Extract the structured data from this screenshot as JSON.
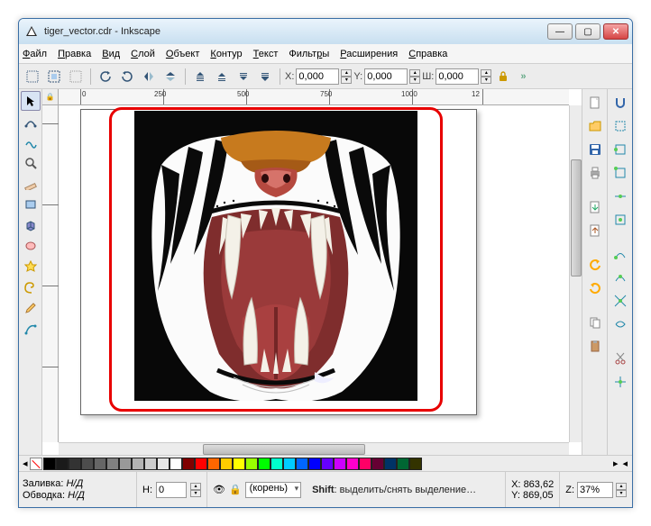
{
  "window": {
    "title": "tiger_vector.cdr - Inkscape"
  },
  "menu": {
    "items": [
      "Файл",
      "Правка",
      "Вид",
      "Слой",
      "Объект",
      "Контур",
      "Текст",
      "Фильтры",
      "Расширения",
      "Справка"
    ]
  },
  "controls": {
    "x_label": "X:",
    "x_value": "0,000",
    "y_label": "Y:",
    "y_value": "0,000",
    "w_label": "Ш:",
    "w_value": "0,000"
  },
  "ruler": {
    "marks": [
      "0",
      "250",
      "500",
      "750",
      "1000",
      "12"
    ]
  },
  "palette": {
    "colors": [
      "#000000",
      "#1a1a1a",
      "#333333",
      "#4d4d4d",
      "#666666",
      "#808080",
      "#999999",
      "#b3b3b3",
      "#cccccc",
      "#e6e6e6",
      "#ffffff",
      "#800000",
      "#ff0000",
      "#ff6600",
      "#ffcc00",
      "#ffff00",
      "#99ff00",
      "#00ff00",
      "#00ffcc",
      "#00ccff",
      "#0066ff",
      "#0000ff",
      "#6600ff",
      "#cc00ff",
      "#ff00cc",
      "#ff0066",
      "#660033",
      "#003366",
      "#006633",
      "#333300"
    ]
  },
  "status": {
    "fill_label": "Заливка:",
    "stroke_label": "Обводка:",
    "na": "Н/Д",
    "h_label": "Н:",
    "h_value": "0",
    "layer": "(корень)",
    "message": "Shift: выделить/снять выделение…",
    "coord_x_label": "X:",
    "coord_x": "863,62",
    "coord_y_label": "Y:",
    "coord_y": "869,05",
    "zoom_label": "Z:",
    "zoom": "37%"
  }
}
